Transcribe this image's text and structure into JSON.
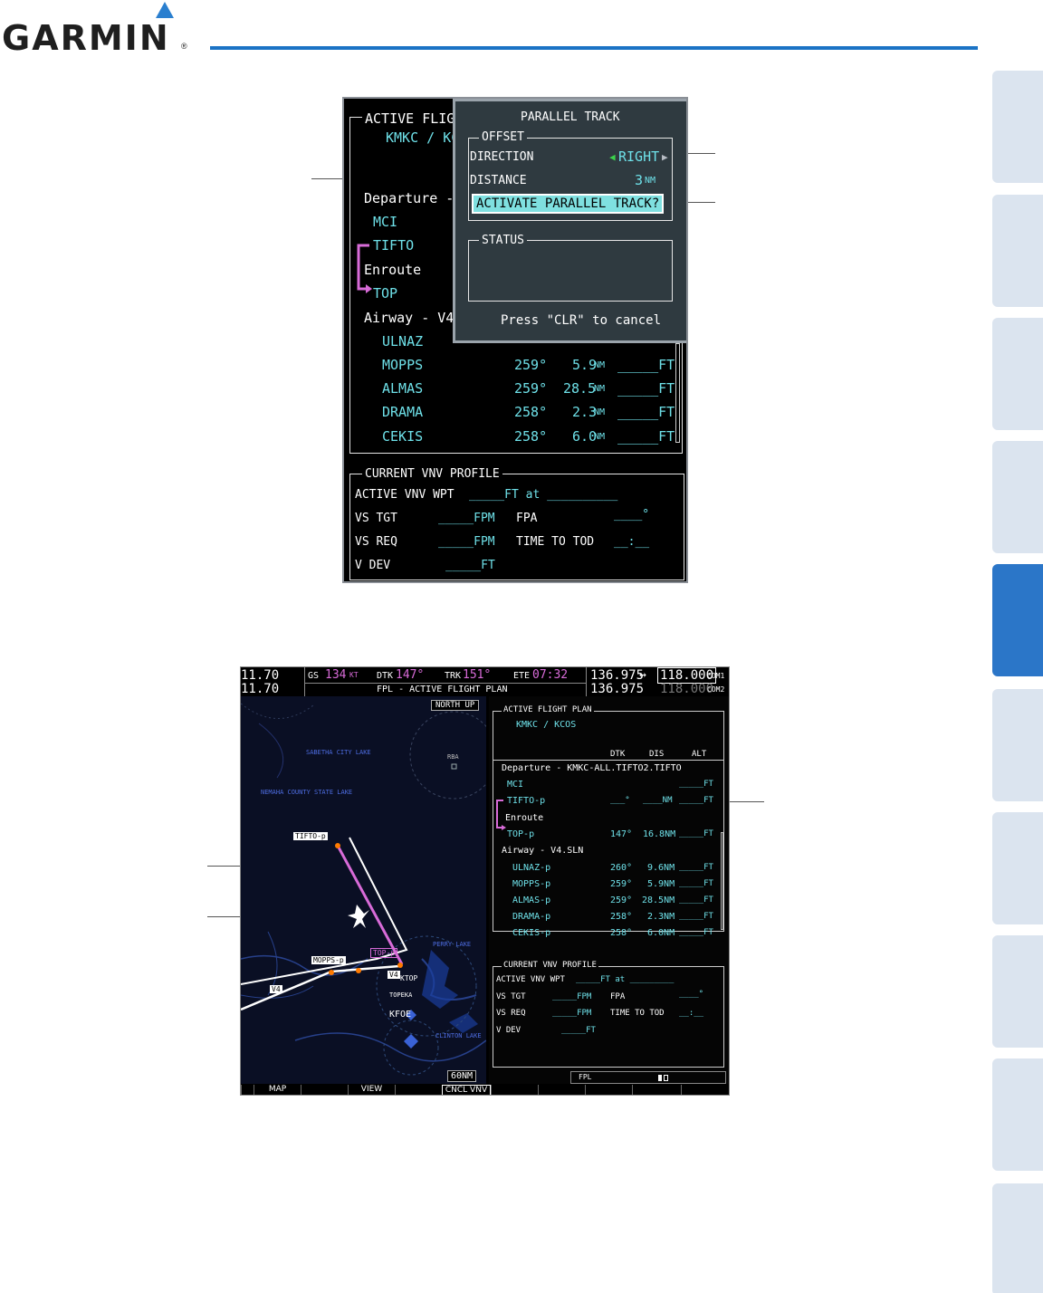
{
  "header": {
    "brand": "GARMIN",
    "registered": "®"
  },
  "fpl1": {
    "box_title": "ACTIVE FLIGHT",
    "route": "KMKC / KC",
    "departure": "Departure - K",
    "wp_mci": "MCI",
    "wp_tifto": "TIFTO",
    "enroute": "Enroute",
    "wp_top": "TOP",
    "airway": "Airway - V4.SL",
    "rows": [
      {
        "wp": "ULNAZ",
        "dtk": "",
        "dis": "",
        "alt": ""
      },
      {
        "wp": "MOPPS",
        "dtk": "259°",
        "dis": "5.9",
        "alt": "_____FT"
      },
      {
        "wp": "ALMAS",
        "dtk": "259°",
        "dis": "28.5",
        "alt": "_____FT"
      },
      {
        "wp": "DRAMA",
        "dtk": "258°",
        "dis": "2.3",
        "alt": "_____FT"
      },
      {
        "wp": "CEKIS",
        "dtk": "258°",
        "dis": "6.0",
        "alt": "_____FT"
      }
    ],
    "nm_unit": "NM",
    "parallel": {
      "title": "PARALLEL TRACK",
      "offset_label": "OFFSET",
      "direction_label": "DIRECTION",
      "direction_value": "RIGHT",
      "distance_label": "DISTANCE",
      "distance_value": "3",
      "distance_unit": "NM",
      "activate": "ACTIVATE PARALLEL TRACK?",
      "status_label": "STATUS",
      "cancel": "Press \"CLR\" to cancel"
    },
    "vnv": {
      "title": "CURRENT VNV PROFILE",
      "active_wpt_label": "ACTIVE VNV WPT",
      "active_wpt_value": "_____FT at __________",
      "vs_tgt_label": "VS TGT",
      "vs_tgt_value": "_____FPM",
      "fpa_label": "FPA",
      "fpa_value": "____°",
      "vs_req_label": "VS REQ",
      "vs_req_value": "_____FPM",
      "tod_label": "TIME TO TOD",
      "tod_value": "__:__",
      "vdev_label": "V DEV",
      "vdev_value": "_____FT"
    }
  },
  "mfd": {
    "nav1": "11.70",
    "nav2": "11.70",
    "gs_label": "GS",
    "gs_value": "134",
    "gs_unit": "KT",
    "dtk_label": "DTK",
    "dtk_value": "147°",
    "trk_label": "TRK",
    "trk_value": "151°",
    "ete_label": "ETE",
    "ete_value": "07:32",
    "page_title": "FPL - ACTIVE FLIGHT PLAN",
    "com1_standby": "136.975",
    "com1_active": "118.000",
    "com1_label": "COM1",
    "com2_standby": "136.975",
    "com2_active": "118.000",
    "com2_label": "COM2",
    "swap": "↔",
    "map": {
      "north_up": "NORTH UP",
      "lake1": "SABETHA CITY LAKE",
      "lake2": "NEMAHA COUNTY STATE LAKE",
      "rba": "RBA",
      "tifto": "TIFTO-p",
      "top": "TOP-p",
      "mopps": "MOPPS-p",
      "v4a": "V4",
      "v4b": "V4",
      "ktop": "KTOP",
      "topeka": "TOPEKA",
      "kfoe": "KFOE",
      "perry": "PERRY LAKE",
      "clinton": "CLINTON LAKE",
      "range": "60NM"
    },
    "fpl": {
      "box_title": "ACTIVE FLIGHT PLAN",
      "route": "KMKC / KCOS",
      "col_dtk": "DTK",
      "col_dis": "DIS",
      "col_alt": "ALT",
      "departure": "Departure - KMKC-ALL.TIFTO2.TIFTO",
      "mci": "MCI",
      "mci_alt": "_____FT",
      "tifto": "TIFTO-p",
      "tifto_dtk": "___°",
      "tifto_dis": "____NM",
      "tifto_alt": "_____FT",
      "enroute": "Enroute",
      "top": "TOP-p",
      "top_dtk": "147°",
      "top_dis": "16.8NM",
      "top_alt": "_____FT",
      "airway": "Airway - V4.SLN",
      "rows": [
        {
          "wp": "ULNAZ-p",
          "dtk": "260°",
          "dis": "9.6NM",
          "alt": "_____FT"
        },
        {
          "wp": "MOPPS-p",
          "dtk": "259°",
          "dis": "5.9NM",
          "alt": "_____FT"
        },
        {
          "wp": "ALMAS-p",
          "dtk": "259°",
          "dis": "28.5NM",
          "alt": "_____FT"
        },
        {
          "wp": "DRAMA-p",
          "dtk": "258°",
          "dis": "2.3NM",
          "alt": "_____FT"
        },
        {
          "wp": "CEKIS-p",
          "dtk": "258°",
          "dis": "6.0NM",
          "alt": "_____FT"
        }
      ],
      "vnv_title": "CURRENT VNV PROFILE",
      "active_wpt_label": "ACTIVE VNV WPT",
      "active_wpt_value": "_____FT at _________",
      "vs_tgt_label": "VS TGT",
      "vs_tgt_value": "_____FPM",
      "fpa_label": "FPA",
      "fpa_value": "____°",
      "vs_req_label": "VS REQ",
      "vs_req_value": "_____FPM",
      "tod_label": "TIME TO TOD",
      "tod_value": "__:__",
      "vdev_label": "V DEV",
      "vdev_value": "_____FT",
      "footer": "FPL"
    },
    "softkeys": [
      "",
      "MAP",
      "",
      "VIEW",
      "",
      "CNCL VNV",
      "",
      "",
      "",
      "",
      ""
    ]
  }
}
